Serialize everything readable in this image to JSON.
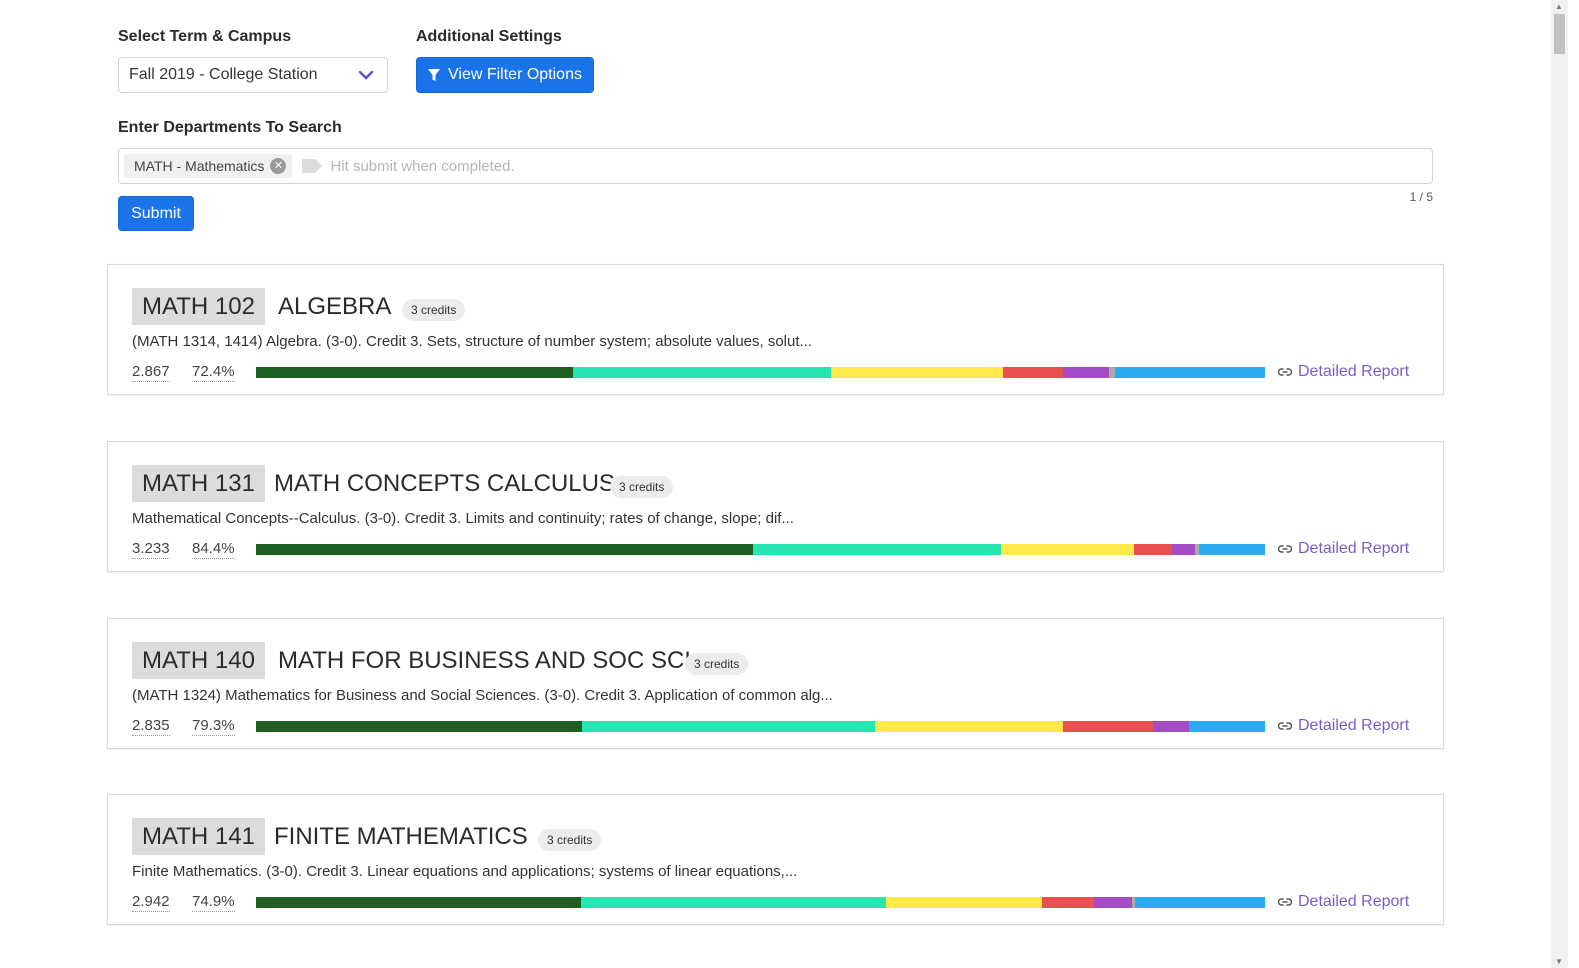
{
  "form": {
    "term_label": "Select Term & Campus",
    "term_value": "Fall 2019 - College Station",
    "settings_label": "Additional Settings",
    "filter_button": "View Filter Options",
    "departments_label": "Enter Departments To Search",
    "tag": "MATH - Mathematics",
    "placeholder": "Hit submit when completed.",
    "counter": "1 / 5",
    "submit": "Submit"
  },
  "colors": {
    "A": "#1e5e20",
    "B": "#26e5b3",
    "C": "#ffe84a",
    "D": "#ea5050",
    "F": "#a64bc6",
    "I": "#aaaaaa",
    "Q": "#2aaaf0",
    "accent": "#1a73e8",
    "link": "#7a5cc8"
  },
  "courses": [
    {
      "code": "MATH 102",
      "title": "ALGEBRA",
      "credits": "3 credits",
      "desc": "(MATH 1314, 1414) Algebra. (3-0). Credit 3. Sets, structure of number system; absolute values, solut...",
      "gpa": "2.867",
      "pass": "72.4%",
      "dist": [
        31.4,
        25.6,
        17.0,
        6.0,
        4.5,
        0.6,
        14.9
      ],
      "link": "Detailed Report"
    },
    {
      "code": "MATH 131",
      "title": "MATH CONCEPTS CALCULUS",
      "credits": "3 credits",
      "desc": "Mathematical Concepts--Calculus. (3-0). Credit 3. Limits and continuity; rates of change, slope; dif...",
      "gpa": "3.233",
      "pass": "84.4%",
      "dist": [
        49.3,
        24.5,
        13.2,
        3.8,
        2.3,
        0.4,
        6.5
      ],
      "link": "Detailed Report"
    },
    {
      "code": "MATH 140",
      "title": "MATH FOR BUSINESS AND SOC SCI",
      "credits": "3 credits",
      "desc": "(MATH 1324) Mathematics for Business and Social Sciences. (3-0). Credit 3. Application of common alg...",
      "gpa": "2.835",
      "pass": "79.3%",
      "dist": [
        32.3,
        29.0,
        18.7,
        8.9,
        3.6,
        0.0,
        7.5
      ],
      "link": "Detailed Report"
    },
    {
      "code": "MATH 141",
      "title": "FINITE MATHEMATICS",
      "credits": "3 credits",
      "desc": "Finite Mathematics. (3-0). Credit 3. Linear equations and applications; systems of linear equations,...",
      "gpa": "2.942",
      "pass": "74.9%",
      "dist": [
        32.2,
        30.2,
        15.5,
        5.2,
        3.7,
        0.3,
        12.9
      ],
      "link": "Detailed Report"
    }
  ]
}
